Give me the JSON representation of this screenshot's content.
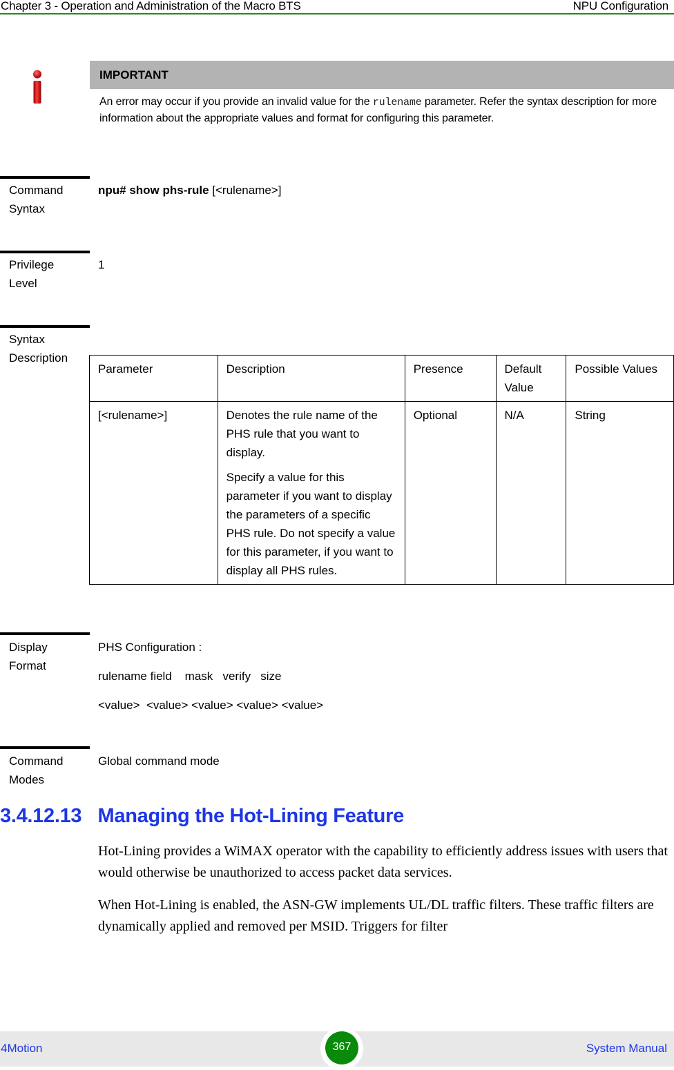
{
  "header": {
    "chapter_title": "Chapter 3 - Operation and Administration of the Macro BTS",
    "section_title": "NPU Configuration"
  },
  "note": {
    "icon": "info-icon",
    "title": "IMPORTANT",
    "text_before": "An error may occur if you provide an invalid value for the ",
    "code": "rulename",
    "text_after": " parameter. Refer the syntax description for more information about the appropriate values and format for configuring this parameter."
  },
  "command_syntax": {
    "label": "Command Syntax",
    "command_bold": "npu# show phs-rule",
    "command_arg": " [<rulename>]"
  },
  "privilege_level": {
    "label": "Privilege Level",
    "value": "1"
  },
  "syntax_description": {
    "label": "Syntax Description",
    "columns": [
      "Parameter",
      "Description",
      "Presence",
      "Default Value",
      "Possible Values"
    ],
    "rows": [
      {
        "parameter": "[<rulename>]",
        "description": [
          "Denotes the rule name of the PHS rule that you want to display.",
          "Specify a value for this parameter if you want to display the parameters of a specific PHS rule. Do not specify a value for this parameter, if you want to display all PHS rules."
        ],
        "presence": "Optional",
        "default_value": "N/A",
        "possible_values": "String"
      }
    ]
  },
  "display_format": {
    "label": "Display Format",
    "lines": [
      "PHS Configuration :",
      "rulename field    mask   verify   size",
      "<value>  <value> <value> <value> <value>"
    ]
  },
  "command_modes": {
    "label": "Command Modes",
    "value": "Global command mode"
  },
  "section": {
    "heading": "3.4.12.13   Managing the Hot-Lining Feature",
    "paragraphs": [
      "Hot-Lining provides a WiMAX operator with the capability to efficiently address issues with users that would otherwise be unauthorized to access packet data services.",
      "When Hot-Lining is enabled, the ASN-GW implements UL/DL traffic filters. These traffic filters are dynamically applied and removed per MSID. Triggers for filter"
    ]
  },
  "footer": {
    "product": "4Motion",
    "page_number": "367",
    "manual": "System Manual"
  },
  "colors": {
    "header_rule": "#1f8a1f",
    "heading_blue": "#1d36e6",
    "note_bar": "#b3b3b3",
    "page_badge": "#0a8a0a",
    "footer_bg": "#e8e8e8"
  }
}
